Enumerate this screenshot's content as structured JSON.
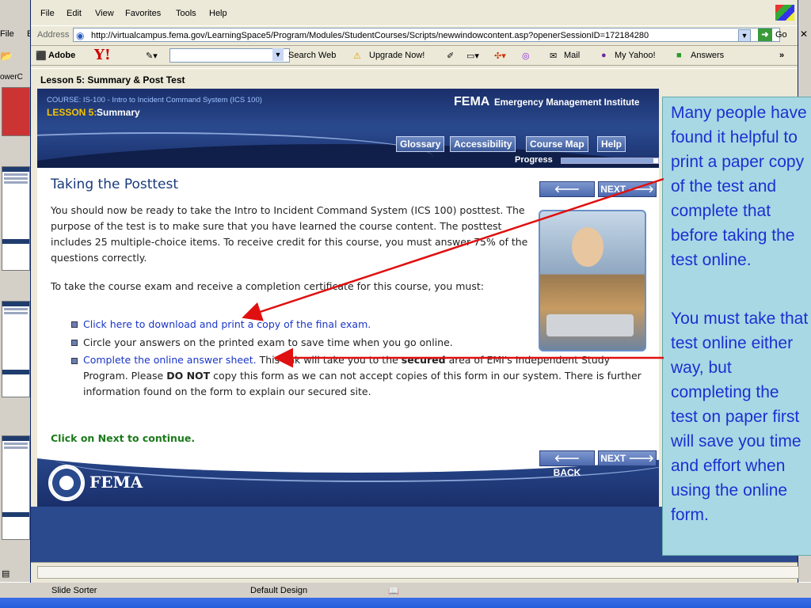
{
  "ppt": {
    "menu_file": "File",
    "menu_e": "E",
    "panel_label": "owerC",
    "status_view": "Slide Sorter",
    "status_design": "Default Design"
  },
  "ie": {
    "menu": [
      "File",
      "Edit",
      "View",
      "Favorites",
      "Tools",
      "Help"
    ],
    "address_label": "Address",
    "address_value": "http://virtualcampus.fema.gov/LearningSpace5/Program/Modules/StudentCourses/Scripts/newwindowcontent.asp?openerSessionID=172184280",
    "go_label": "Go",
    "toolbar": {
      "adobe": "Adobe",
      "yahoo": "Y!",
      "search_web": "Search Web",
      "upgrade": "Upgrade Now!",
      "mail": "Mail",
      "my_yahoo": "My Yahoo!",
      "answers": "Answers",
      "more": "»"
    },
    "page_title": "Lesson 5: Summary & Post Test"
  },
  "page": {
    "course_line": "COURSE: IS-100 - Intro to Incident Command System (ICS 100)",
    "lesson_prefix": "LESSON 5:",
    "lesson_name": "Summary",
    "brand": "FEMA",
    "brand_sub": "Emergency Management Institute",
    "nav": [
      "Glossary",
      "Accessibility",
      "Course Map",
      "Help"
    ],
    "progress_label": "Progress",
    "progress_fraction": 0.95,
    "heading": "Taking the Posttest",
    "back_label": "BACK",
    "next_label": "NEXT",
    "para1": "You should now be ready to take the Intro to Incident Command System (ICS 100) posttest. The purpose of the test is to make sure that you have learned the course content. The posttest includes 25 multiple-choice items. To receive credit for this course, you must answer 75% of the questions correctly.",
    "para2": "To take the course exam and receive a completion certificate for this course, you must:",
    "bullet1_link": "Click here to download and print a copy of the final exam.",
    "bullet2": "Circle your answers on the printed exam to save time when you go online.",
    "bullet3_link": "Complete the online answer sheet.",
    "bullet3_rest_a": " This link will take you to the ",
    "bullet3_secured": "secured",
    "bullet3_rest_b": " area of EMI's Independent Study Program. Please ",
    "bullet3_donot": "DO NOT",
    "bullet3_rest_c": " copy this form as we can not accept copies of this form in our system. There is further information found on the form to explain our secured site.",
    "continue_text": "Click on Next to continue.",
    "footer_brand": "FEMA"
  },
  "callout": {
    "text1": "Many people have found it helpful to print a paper copy of the test and complete that before taking the test online.",
    "text2": "You must take that test online either way, but completing the test on paper first will save you time and effort when using the online form."
  },
  "colors": {
    "navy": "#1a2f6b",
    "callout_bg": "#a8d8e4",
    "callout_text": "#1c2fd0",
    "arrow": "#e01010",
    "link": "#1a35c8",
    "continue": "#1a7a1a"
  }
}
